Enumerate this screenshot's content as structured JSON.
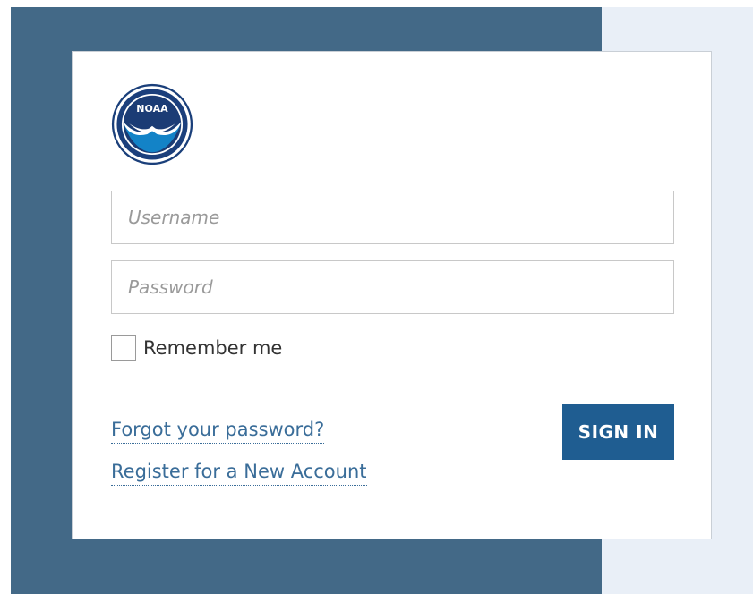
{
  "login": {
    "logo_icon": "noaa-logo-icon",
    "logo_text": "NOAA",
    "username": {
      "placeholder": "Username",
      "value": ""
    },
    "password": {
      "placeholder": "Password",
      "value": ""
    },
    "remember_label": "Remember me",
    "remember_checked": false,
    "forgot_link": "Forgot your password?",
    "register_link": "Register for a New Account",
    "signin_label": "SIGN IN"
  },
  "colors": {
    "background_dark": "#436987",
    "background_light": "#e9eff7",
    "card": "#ffffff",
    "link": "#3a6d99",
    "button": "#1f5d91"
  }
}
